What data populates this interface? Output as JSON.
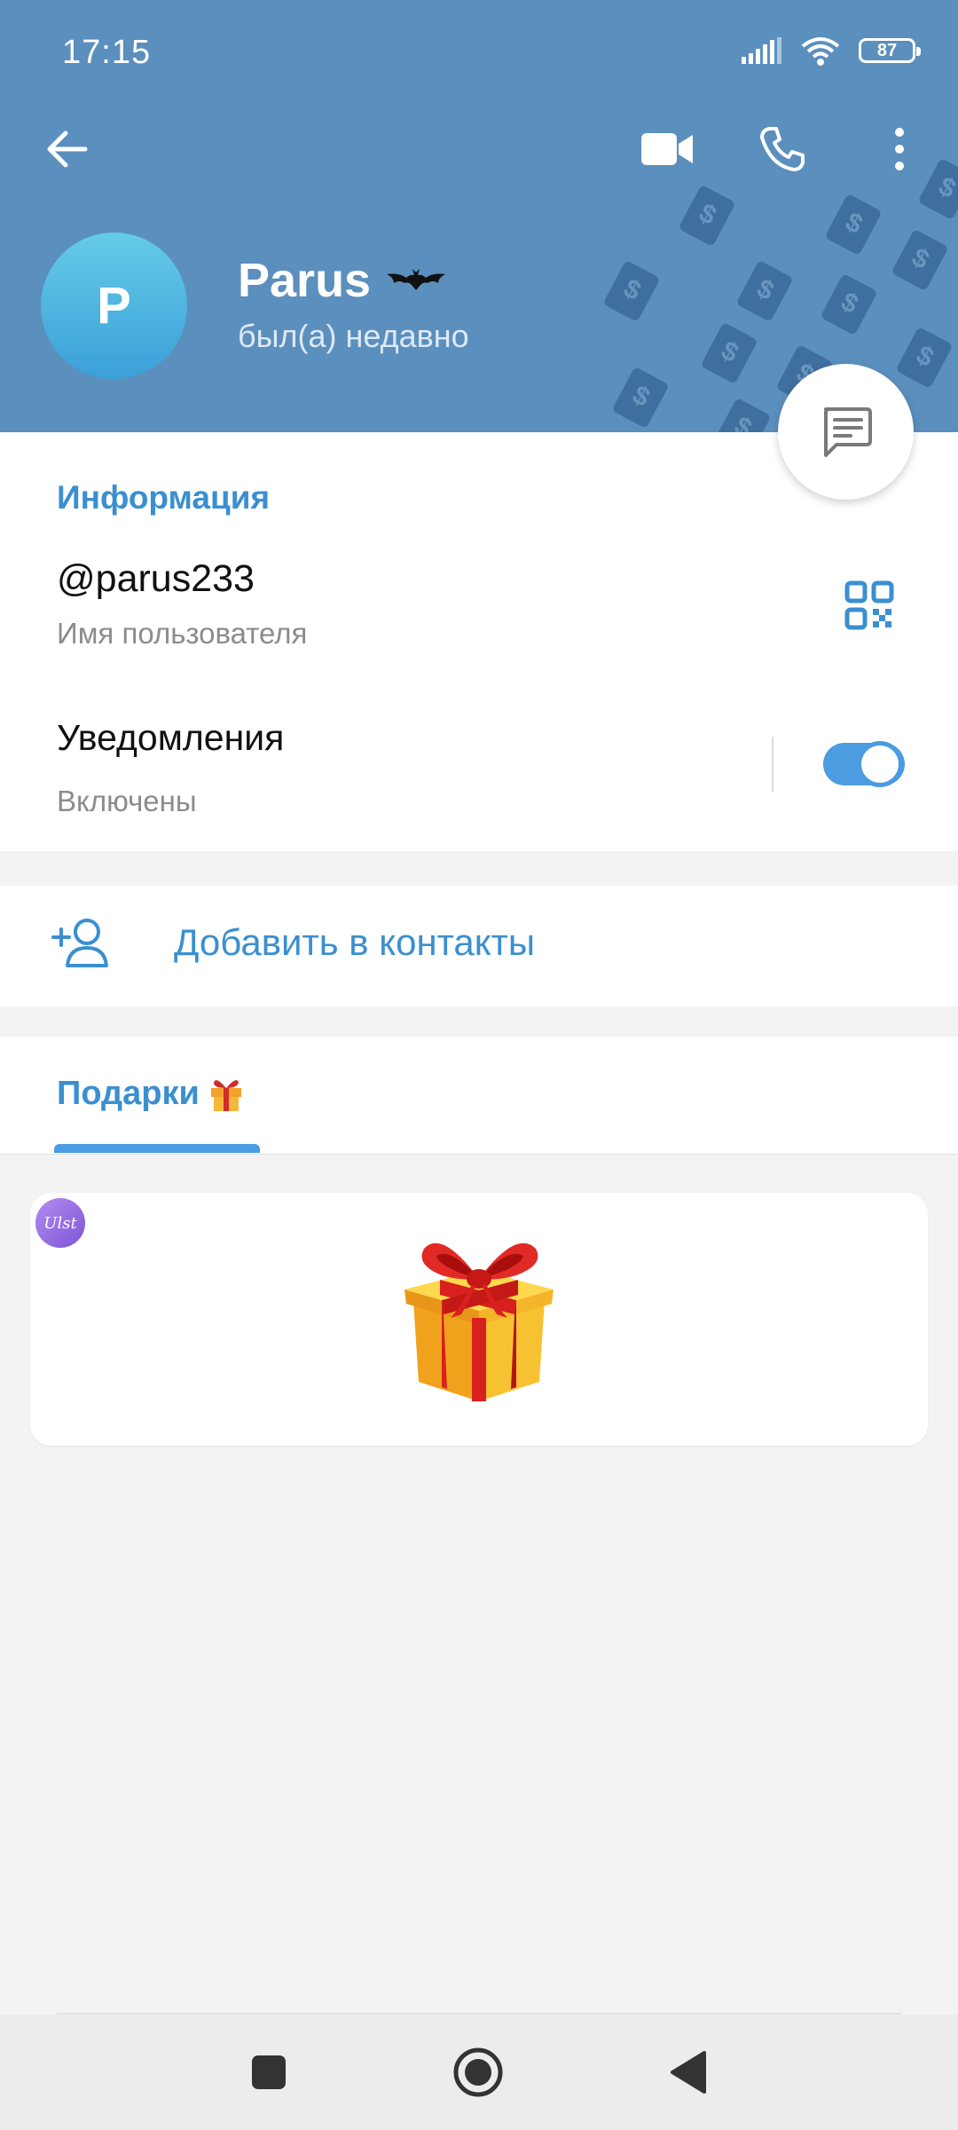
{
  "status_bar": {
    "time": "17:15",
    "battery": "87"
  },
  "header": {
    "avatar_letter": "P",
    "name": "Parus",
    "last_seen": "был(а) недавно"
  },
  "info": {
    "section_title": "Информация",
    "username": "@parus233",
    "username_label": "Имя пользователя",
    "notifications_title": "Уведомления",
    "notifications_status": "Включены",
    "notifications_enabled": true
  },
  "actions": {
    "add_contact": "Добавить в контакты"
  },
  "tabs": {
    "gifts": "Подарки"
  },
  "gift": {
    "badge_text": "Ulst"
  },
  "colors": {
    "header": "#5b8fbd",
    "accent": "#3a8fd0",
    "toggle": "#4b9ce0"
  }
}
